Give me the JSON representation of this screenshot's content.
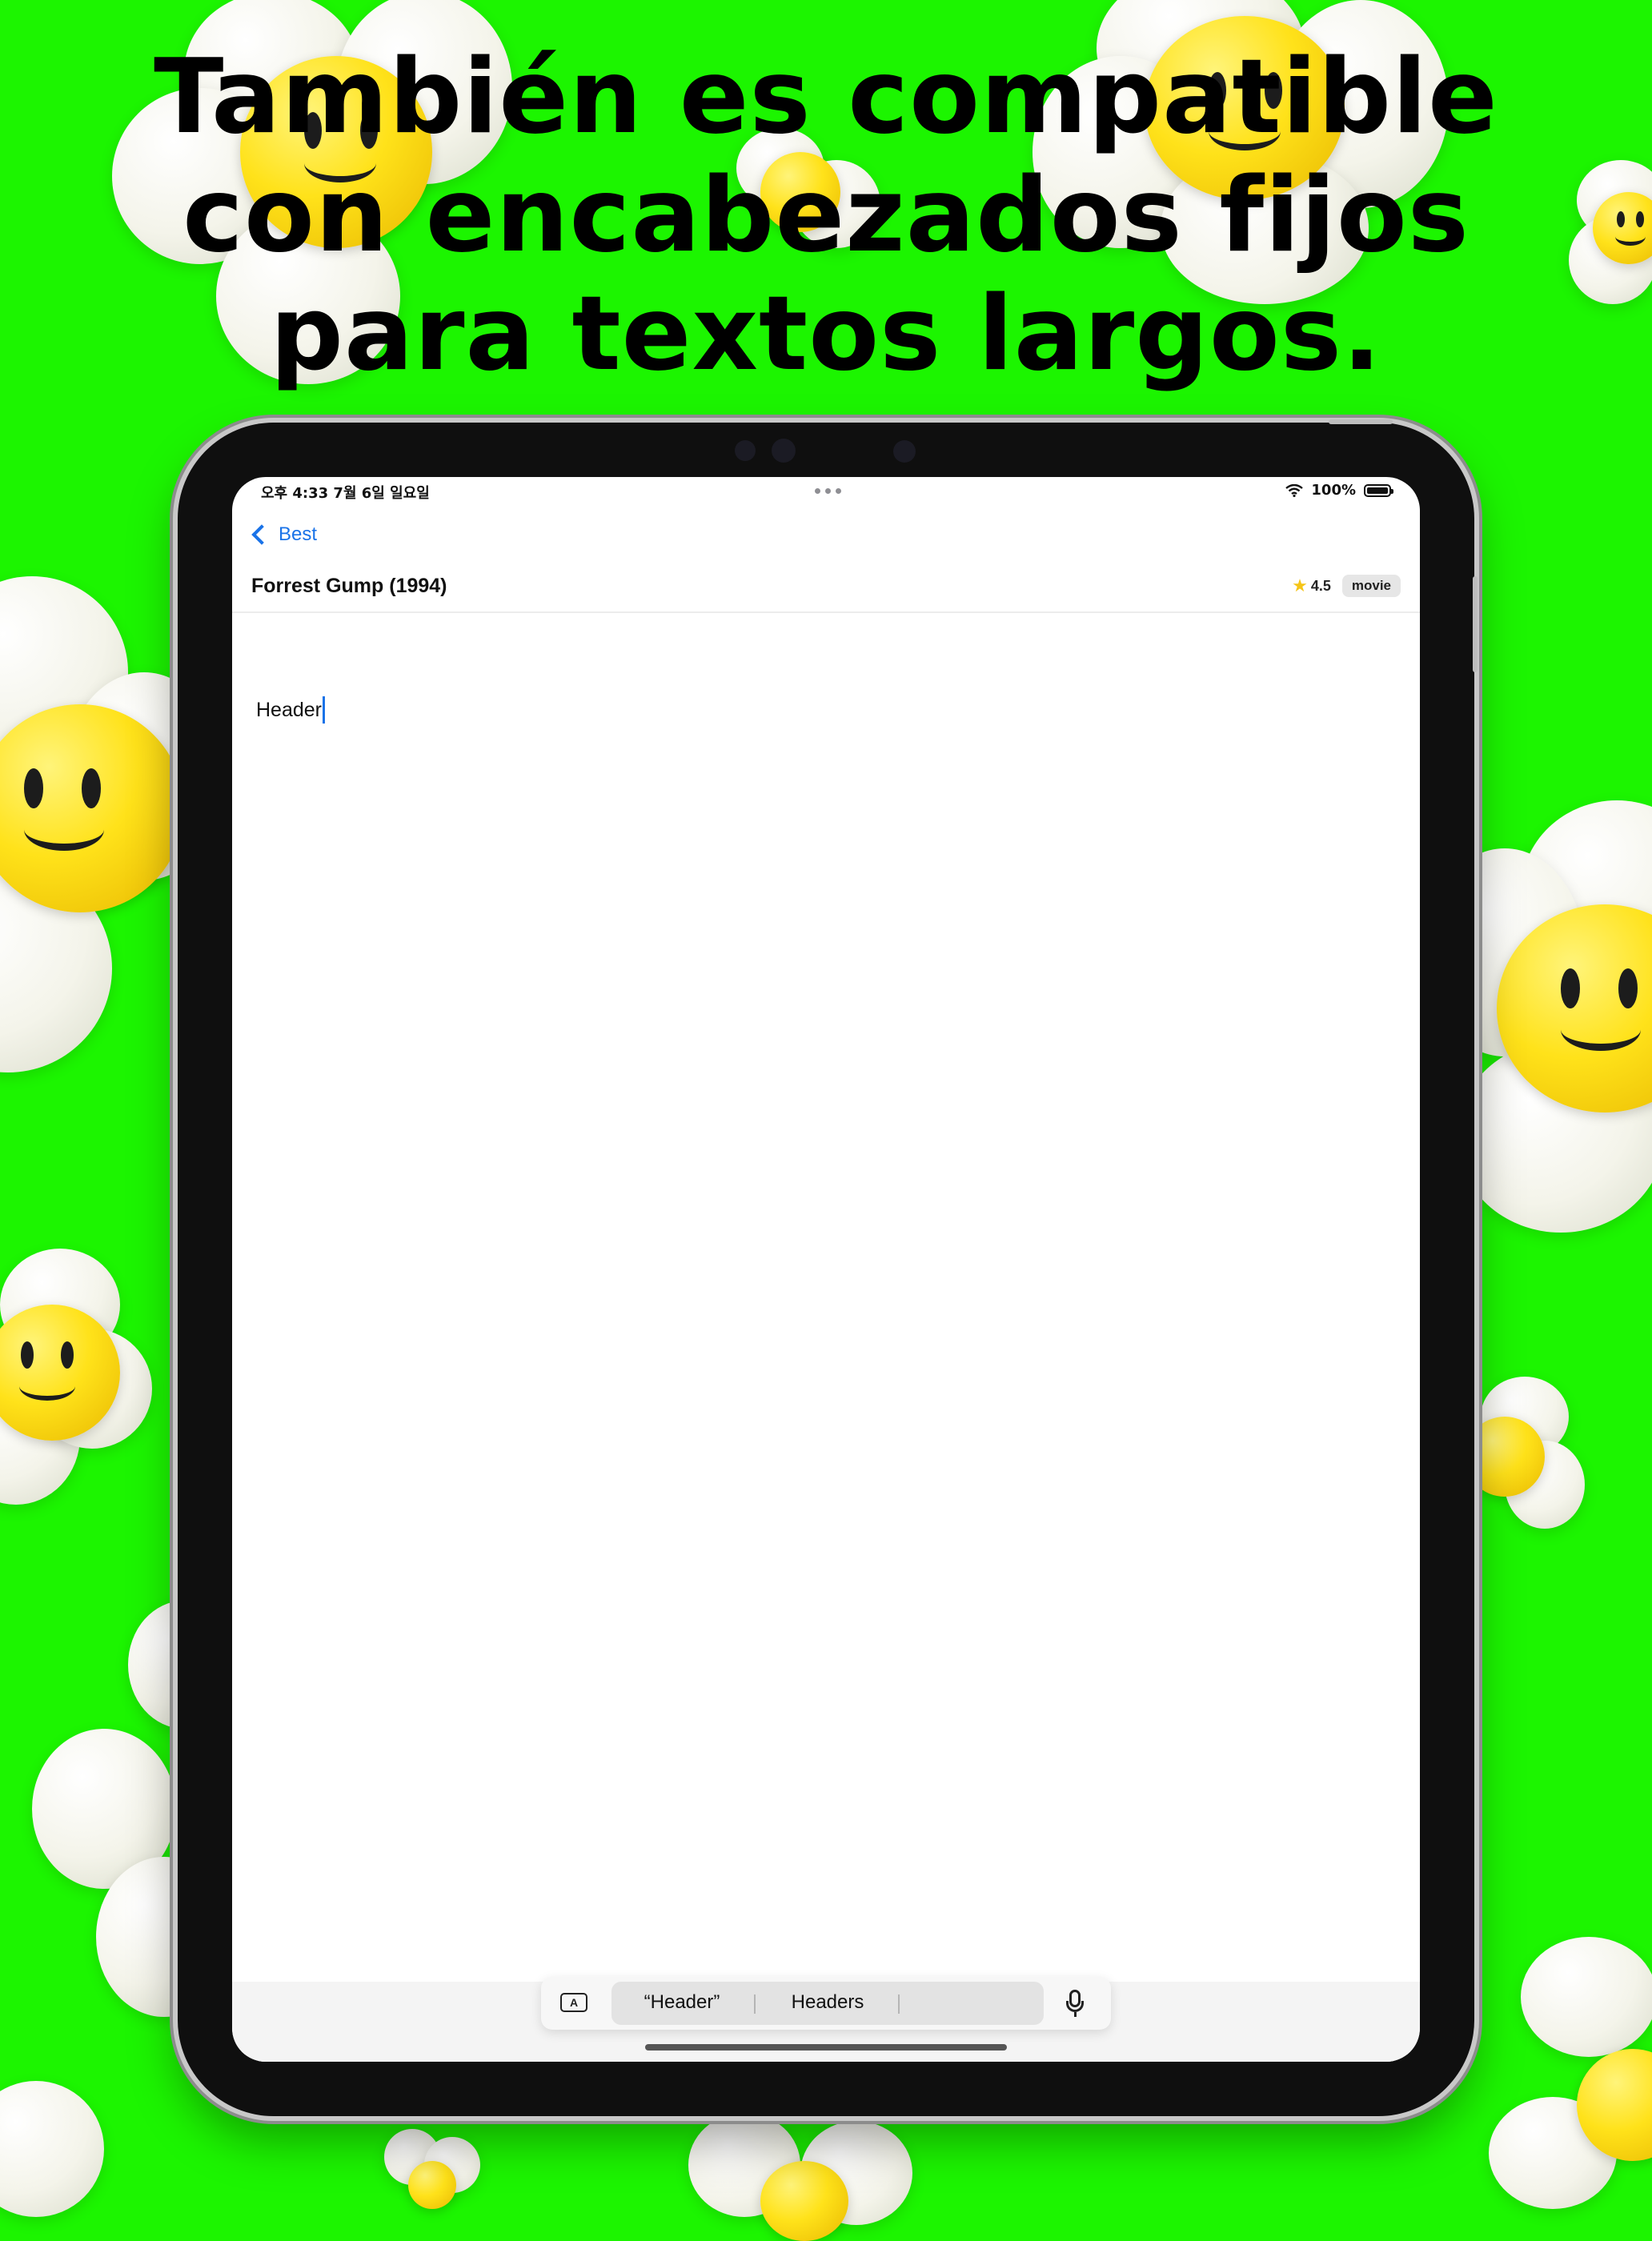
{
  "headline": {
    "line1": "También es compatible",
    "line2": "con encabezados fijos",
    "line3": "para textos largos."
  },
  "status_bar": {
    "time": "오후 4:33   7월 6일 일요일",
    "battery": "100%",
    "wifi_icon": "wifi-icon"
  },
  "nav": {
    "back_label": "Best"
  },
  "document": {
    "title": "Forrest Gump (1994)",
    "rating": "4.5",
    "tag": "movie",
    "body_text": "Header"
  },
  "keyboard": {
    "suggestions": [
      "“Header”",
      "Headers",
      ""
    ]
  },
  "colors": {
    "background": "#1cf500",
    "accent": "#1a73e8",
    "star": "#f5c518"
  }
}
